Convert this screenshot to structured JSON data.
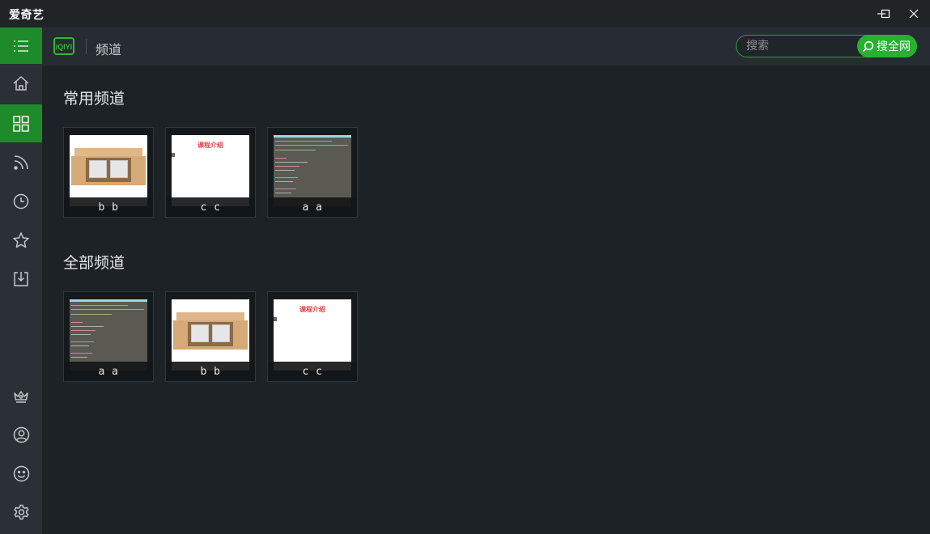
{
  "app": {
    "title": "爱奇艺"
  },
  "window_controls": {
    "minimize": "minimize-icon",
    "maximize": "maximize-icon",
    "close": "close-icon"
  },
  "header": {
    "logo_text": "iQIYI",
    "title": "频道",
    "search": {
      "placeholder": "搜索",
      "value": "",
      "button_label": "搜全网"
    }
  },
  "sidebar": {
    "items": [
      {
        "name": "menu",
        "icon": "menu-icon"
      },
      {
        "name": "home",
        "icon": "home-icon"
      },
      {
        "name": "channels",
        "icon": "grid-icon",
        "active": true
      },
      {
        "name": "feed",
        "icon": "rss-icon"
      },
      {
        "name": "history",
        "icon": "clock-icon"
      },
      {
        "name": "favorites",
        "icon": "star-icon"
      },
      {
        "name": "downloads",
        "icon": "download-icon"
      },
      {
        "name": "vip",
        "icon": "crown-icon"
      },
      {
        "name": "account",
        "icon": "user-icon"
      },
      {
        "name": "feedback",
        "icon": "smile-icon"
      },
      {
        "name": "settings",
        "icon": "gear-icon"
      }
    ]
  },
  "sections": [
    {
      "title": "常用频道",
      "cards": [
        {
          "label": "b b",
          "thumb": "box",
          "thumb_text": ""
        },
        {
          "label": "c c",
          "thumb": "doc",
          "thumb_text": "课程介绍"
        },
        {
          "label": "a a",
          "thumb": "code",
          "thumb_text": ""
        }
      ]
    },
    {
      "title": "全部频道",
      "cards": [
        {
          "label": "a a",
          "thumb": "code",
          "thumb_text": ""
        },
        {
          "label": "b b",
          "thumb": "box",
          "thumb_text": ""
        },
        {
          "label": "c c",
          "thumb": "doc",
          "thumb_text": "课程介绍"
        }
      ]
    }
  ],
  "colors": {
    "accent": "#28b12f",
    "sidebar_active": "#1e8a2a",
    "background": "#1c2226"
  }
}
